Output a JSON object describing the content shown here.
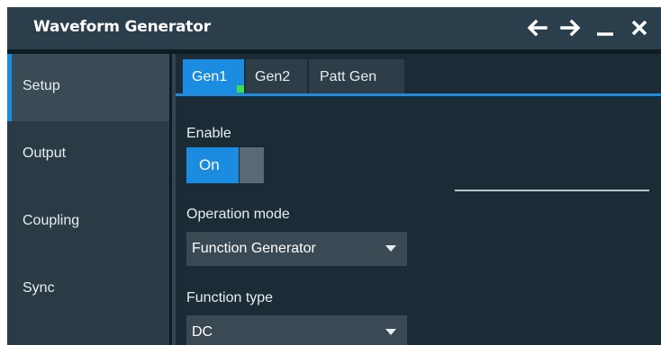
{
  "window": {
    "title": "Waveform Generator"
  },
  "titlebar_icons": [
    "back-arrow-icon",
    "forward-arrow-icon",
    "minimize-icon",
    "close-icon"
  ],
  "sidebar": {
    "items": [
      {
        "label": "Setup",
        "active": true
      },
      {
        "label": "Output",
        "active": false
      },
      {
        "label": "Coupling",
        "active": false
      },
      {
        "label": "Sync",
        "active": false
      }
    ]
  },
  "tabs": [
    {
      "label": "Gen1",
      "active": true
    },
    {
      "label": "Gen2",
      "active": false
    },
    {
      "label": "Patt Gen",
      "active": false
    }
  ],
  "setup": {
    "enable_label": "Enable",
    "enable_value": "On",
    "operation_mode_label": "Operation mode",
    "operation_mode_value": "Function Generator",
    "function_type_label": "Function type",
    "function_type_value": "DC"
  },
  "colors": {
    "accent": "#1b8ce0",
    "status_green": "#39e04b",
    "titlebar_bg": "#2a3f4b",
    "sidebar_bg": "#2b3b46",
    "content_bg": "#1c2c37"
  }
}
